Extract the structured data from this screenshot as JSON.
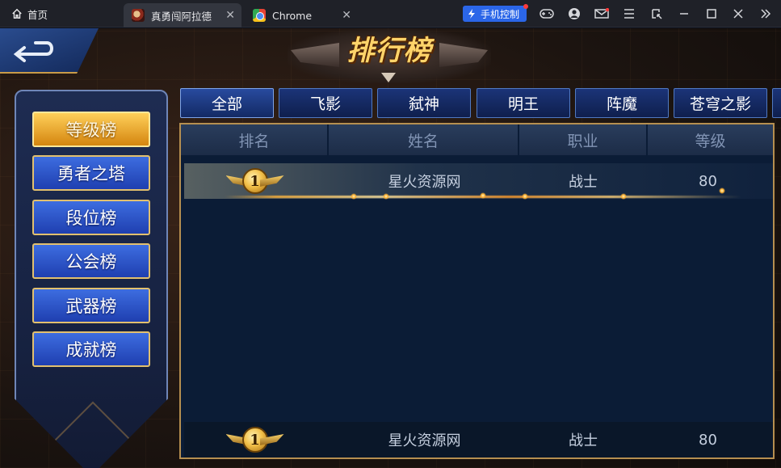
{
  "browser": {
    "home_label": "首页",
    "tabs": [
      {
        "label": "真勇闯阿拉德",
        "active": true
      },
      {
        "label": "Chrome",
        "active": false
      }
    ],
    "tab_close_glyph": "✕",
    "phone_control_label": "手机控制"
  },
  "game": {
    "title": "排行榜",
    "side_menu": [
      {
        "label": "等级榜",
        "active": true
      },
      {
        "label": "勇者之塔",
        "active": false
      },
      {
        "label": "段位榜",
        "active": false
      },
      {
        "label": "公会榜",
        "active": false
      },
      {
        "label": "武器榜",
        "active": false
      },
      {
        "label": "成就榜",
        "active": false
      }
    ],
    "categories": [
      {
        "label": "全部",
        "active": true
      },
      {
        "label": "飞影",
        "active": false
      },
      {
        "label": "弑神",
        "active": false
      },
      {
        "label": "明王",
        "active": false
      },
      {
        "label": "阵魔",
        "active": false
      },
      {
        "label": "苍穹之影",
        "active": false
      }
    ],
    "table": {
      "headers": [
        "排名",
        "姓名",
        "职业",
        "等级"
      ],
      "rows": [
        {
          "rank": "1",
          "name": "星火资源网",
          "job": "战士",
          "level": "80"
        }
      ],
      "my_rank": {
        "rank": "1",
        "name": "星火资源网",
        "job": "战士",
        "level": "80"
      }
    }
  },
  "colors": {
    "accent_gold": "#e2c06e",
    "menu_blue": "#2b57cc",
    "active_orange": "#f0a52a",
    "table_bg": "#0b1c36"
  }
}
